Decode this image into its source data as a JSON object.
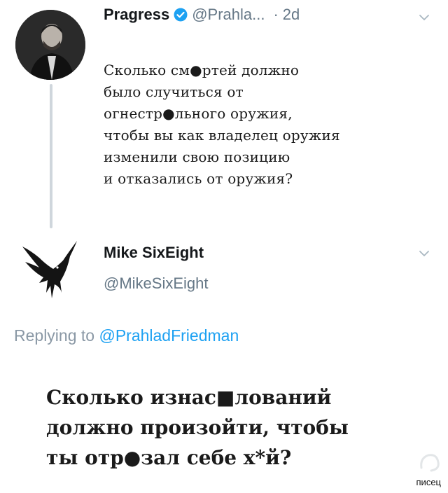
{
  "original_tweet": {
    "display_name": "Pragress",
    "handle": "@Prahla...",
    "separator": "·",
    "time_ago": "2d",
    "text_lines": [
      "Сколько см●ртей должно",
      "было случиться от",
      "огнестр●льного оружия,",
      "чтобы вы как владелец оружия",
      "изменили свою позицию",
      "и отказались от оружия?"
    ],
    "icons": {
      "verified": "verified-badge-icon",
      "menu": "chevron-down-icon"
    }
  },
  "reply_tweet": {
    "display_name": "Mike SixEight",
    "handle": "@MikeSixEight",
    "replying_prefix": "Replying to",
    "replying_to": "@PrahladFriedman",
    "text_lines": [
      "Сколько изнас■лований",
      "должно произойти, чтобы",
      "ты отр●зал себе х*й?"
    ],
    "icons": {
      "avatar": "crow-avatar-icon",
      "menu": "chevron-down-icon"
    }
  },
  "watermark": "писец",
  "colors": {
    "muted": "#657786",
    "link": "#1da1f2",
    "verified": "#1da1f2"
  }
}
